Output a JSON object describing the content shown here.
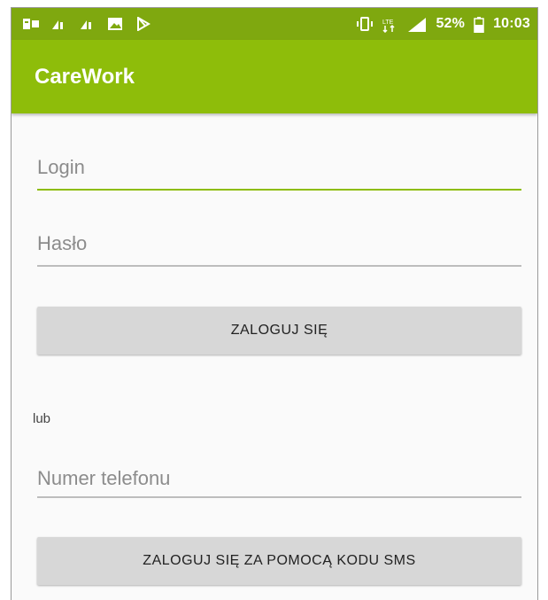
{
  "status_bar": {
    "battery_percent": "52%",
    "time": "10:03",
    "network_label": "LTE",
    "left_icons": [
      "message-icon",
      "signal-icon",
      "signal-icon",
      "image-icon",
      "play-store-icon"
    ],
    "right_icons": [
      "vibrate-icon",
      "lte-icon",
      "cell-signal-icon",
      "battery-icon"
    ],
    "color": "#7fa80f"
  },
  "app_bar": {
    "title": "CareWork",
    "color": "#8ebd0a"
  },
  "login_form": {
    "login_placeholder": "Login",
    "password_placeholder": "Hasło",
    "login_button": "ZALOGUJ SIĘ",
    "separator_text": "lub",
    "phone_placeholder": "Numer telefonu",
    "sms_button": "ZALOGUJ SIĘ ZA POMOCĄ KODU SMS"
  },
  "colors": {
    "accent": "#8ebd0a",
    "button_bg": "#d7d7d7",
    "placeholder": "#8c8c8c"
  }
}
